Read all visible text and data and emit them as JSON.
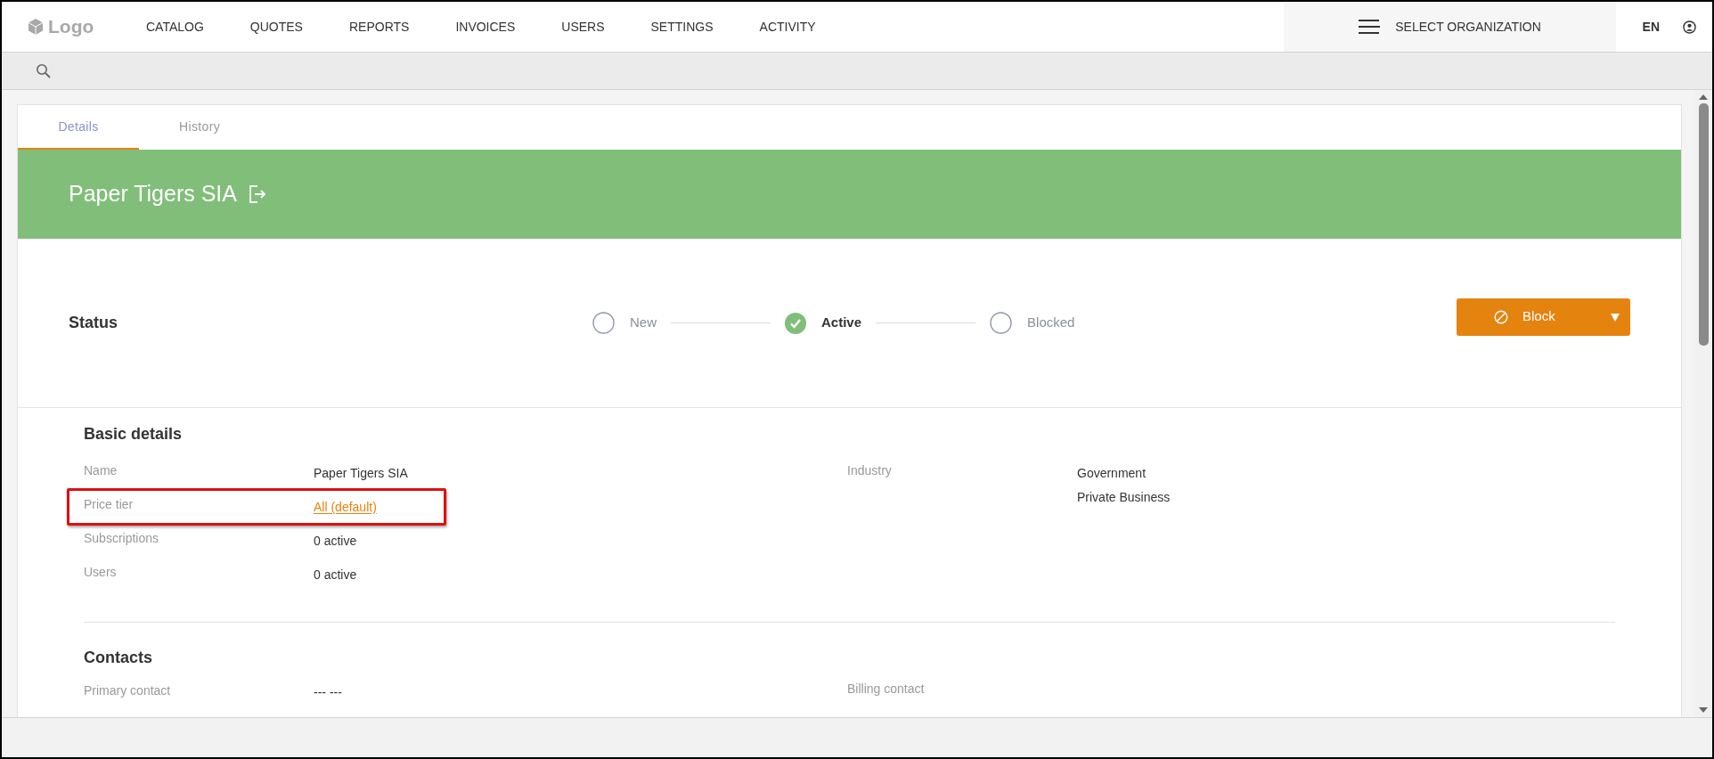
{
  "header": {
    "logo": "Logo",
    "nav": [
      "CATALOG",
      "QUOTES",
      "REPORTS",
      "INVOICES",
      "USERS",
      "SETTINGS",
      "ACTIVITY"
    ],
    "organization": "SELECT ORGANIZATION",
    "language": "EN"
  },
  "tabs": [
    {
      "label": "Details",
      "selected": true
    },
    {
      "label": "History",
      "selected": false
    }
  ],
  "banner": {
    "title": "Paper Tigers SIA"
  },
  "status": {
    "label": "Status",
    "steps": [
      {
        "label": "New",
        "selected": false
      },
      {
        "label": "Active",
        "selected": true
      },
      {
        "label": "Blocked",
        "selected": false
      }
    ],
    "action": "Block"
  },
  "basic_details": {
    "title": "Basic details",
    "left": [
      {
        "label": "Name",
        "value": "Paper Tigers SIA",
        "kind": "text",
        "highlighted": false
      },
      {
        "label": "Price tier",
        "value": "All (default)",
        "kind": "link",
        "highlighted": true
      },
      {
        "label": "Subscriptions",
        "value": "0 active",
        "kind": "text",
        "highlighted": false
      },
      {
        "label": "Users",
        "value": "0 active",
        "kind": "text",
        "highlighted": false
      }
    ],
    "right": [
      {
        "label": "Industry",
        "values": [
          "Government",
          "Private Business"
        ]
      }
    ]
  },
  "contacts": {
    "title": "Contacts",
    "left": [
      {
        "label": "Primary contact",
        "value": "--- ---"
      }
    ],
    "right": [
      {
        "label": "Billing contact"
      }
    ]
  }
}
